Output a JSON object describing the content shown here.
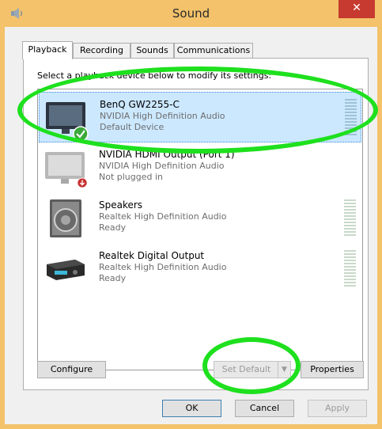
{
  "window": {
    "title": "Sound",
    "close_glyph": "✕"
  },
  "tabs": [
    {
      "label": "Playback",
      "active": true
    },
    {
      "label": "Recording",
      "active": false
    },
    {
      "label": "Sounds",
      "active": false
    },
    {
      "label": "Communications",
      "active": false
    }
  ],
  "instruction": "Select a playback device below to modify its settings:",
  "devices": [
    {
      "name": "BenQ GW2255-C",
      "driver": "NVIDIA High Definition Audio",
      "status": "Default Device",
      "icon": "monitor-icon",
      "badge": "default-check-icon",
      "selected": true
    },
    {
      "name": "NVIDIA HDMI Output (Port 1)",
      "driver": "NVIDIA High Definition Audio",
      "status": "Not plugged in",
      "icon": "monitor-icon",
      "badge": "unplugged-icon",
      "selected": false
    },
    {
      "name": "Speakers",
      "driver": "Realtek High Definition Audio",
      "status": "Ready",
      "icon": "speaker-icon",
      "badge": "",
      "selected": false
    },
    {
      "name": "Realtek Digital Output",
      "driver": "Realtek High Definition Audio",
      "status": "Ready",
      "icon": "receiver-icon",
      "badge": "",
      "selected": false
    }
  ],
  "buttons": {
    "configure": "Configure",
    "set_default": "Set Default",
    "properties": "Properties",
    "ok": "OK",
    "cancel": "Cancel",
    "apply": "Apply"
  },
  "colors": {
    "accent_frame": "#f3c26a",
    "selection": "#cce8ff",
    "highlight_annotation": "#1ee01e",
    "close_button": "#c73a30"
  }
}
